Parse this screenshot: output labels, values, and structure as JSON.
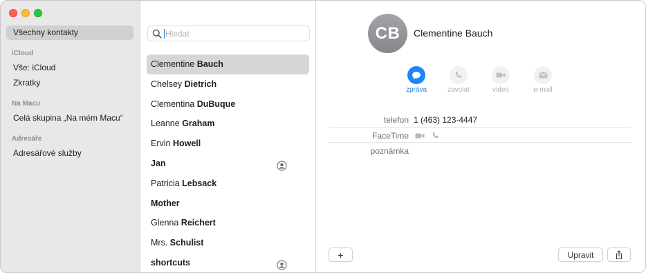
{
  "sidebar": {
    "all_contacts": "Všechny kontakty",
    "icloud_header": "iCloud",
    "icloud_all": "Vše: iCloud",
    "shortcuts": "Zkratky",
    "mac_header": "Na Macu",
    "mac_group": "Celá skupina „Na mém Macu“",
    "directories_header": "Adresáře",
    "directory_services": "Adresářové služby"
  },
  "search": {
    "placeholder": "Hledat"
  },
  "contacts": [
    {
      "first": "Clementine",
      "last": "Bauch",
      "selected": true,
      "icon": ""
    },
    {
      "first": "Chelsey",
      "last": "Dietrich",
      "icon": ""
    },
    {
      "first": "Clementina",
      "last": "DuBuque",
      "icon": ""
    },
    {
      "first": "Leanne",
      "last": "Graham",
      "icon": ""
    },
    {
      "first": "Ervin",
      "last": "Howell",
      "icon": ""
    },
    {
      "first": "",
      "last": "Jan",
      "icon": "person-circle-icon"
    },
    {
      "first": "Patricia",
      "last": "Lebsack",
      "icon": ""
    },
    {
      "first": "",
      "last": "Mother",
      "icon": ""
    },
    {
      "first": "Glenna",
      "last": "Reichert",
      "icon": ""
    },
    {
      "first": "Mrs.",
      "last": "Schulist",
      "icon": ""
    },
    {
      "first": "",
      "last": "shortcuts",
      "icon": "person-circle-icon"
    }
  ],
  "detail": {
    "initials": "CB",
    "name": "Clementine Bauch",
    "actions": [
      {
        "label": "zpráva",
        "icon": "message-bubble-icon",
        "active": true
      },
      {
        "label": "zavolat",
        "icon": "phone-icon",
        "active": false
      },
      {
        "label": "video",
        "icon": "video-camera-icon",
        "active": false
      },
      {
        "label": "e-mail",
        "icon": "envelope-icon",
        "active": false
      }
    ],
    "phone_label": "telefon",
    "phone_value": "1 (463) 123-4447",
    "facetime_label": "FaceTime",
    "note_label": "poznámka",
    "add_button": "+",
    "edit_button": "Upravit"
  },
  "colors": {
    "accent": "#1b86f4",
    "sidebar_bg": "#e8e8e8",
    "selection": "#d6d6d6"
  }
}
